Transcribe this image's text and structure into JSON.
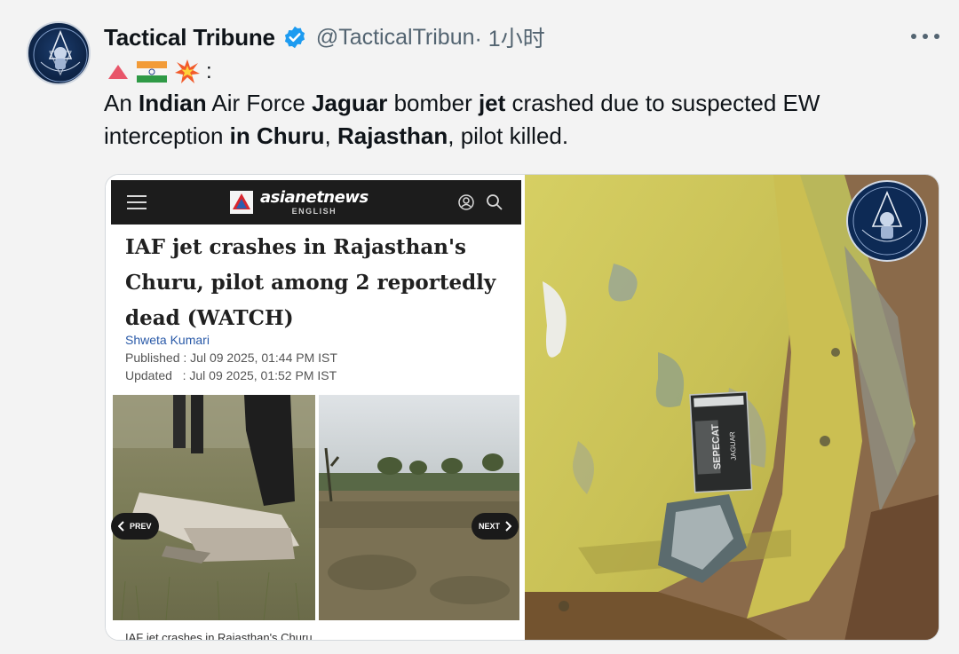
{
  "tweet": {
    "display_name": "Tactical Tribune",
    "verified_icon": "verified-badge-icon",
    "handle": "@TacticalTribun",
    "time": " · 1小时",
    "more_icon": "more-options-icon",
    "emojis": [
      "red-triangle-icon",
      "india-flag-icon",
      "collision-icon"
    ],
    "emoji_suffix": ":",
    "text": {
      "t1": "An ",
      "t2": "Indian",
      "t3": " Air Force ",
      "t4": "Jaguar",
      "t5": " bomber ",
      "t6": "jet",
      "t7": " crashed due to suspected EW interception ",
      "t8": "in Churu",
      "t9": ", ",
      "t10": "Rajasthan",
      "t11": ", pilot killed."
    }
  },
  "article": {
    "brand": "asianetnews",
    "brand_sub": "ENGLISH",
    "headline": "IAF jet crashes in Rajasthan's Churu, pilot among 2 reportedly dead (WATCH)",
    "author": "Shweta Kumari",
    "published": "Published : Jul 09 2025, 01:44 PM IST",
    "updated": "Updated   : Jul 09 2025, 01:52 PM IST",
    "prev_label": "PREV",
    "next_label": "NEXT",
    "caption": "IAF jet crashes in Rajasthan's Churu"
  },
  "wreckage": {
    "plate_text_1": "SEPECAT",
    "plate_text_2": "JAGUAR"
  },
  "colors": {
    "verified_blue": "#1d9bf0",
    "handle_gray": "#536471",
    "link_blue": "#2a5aa8"
  }
}
